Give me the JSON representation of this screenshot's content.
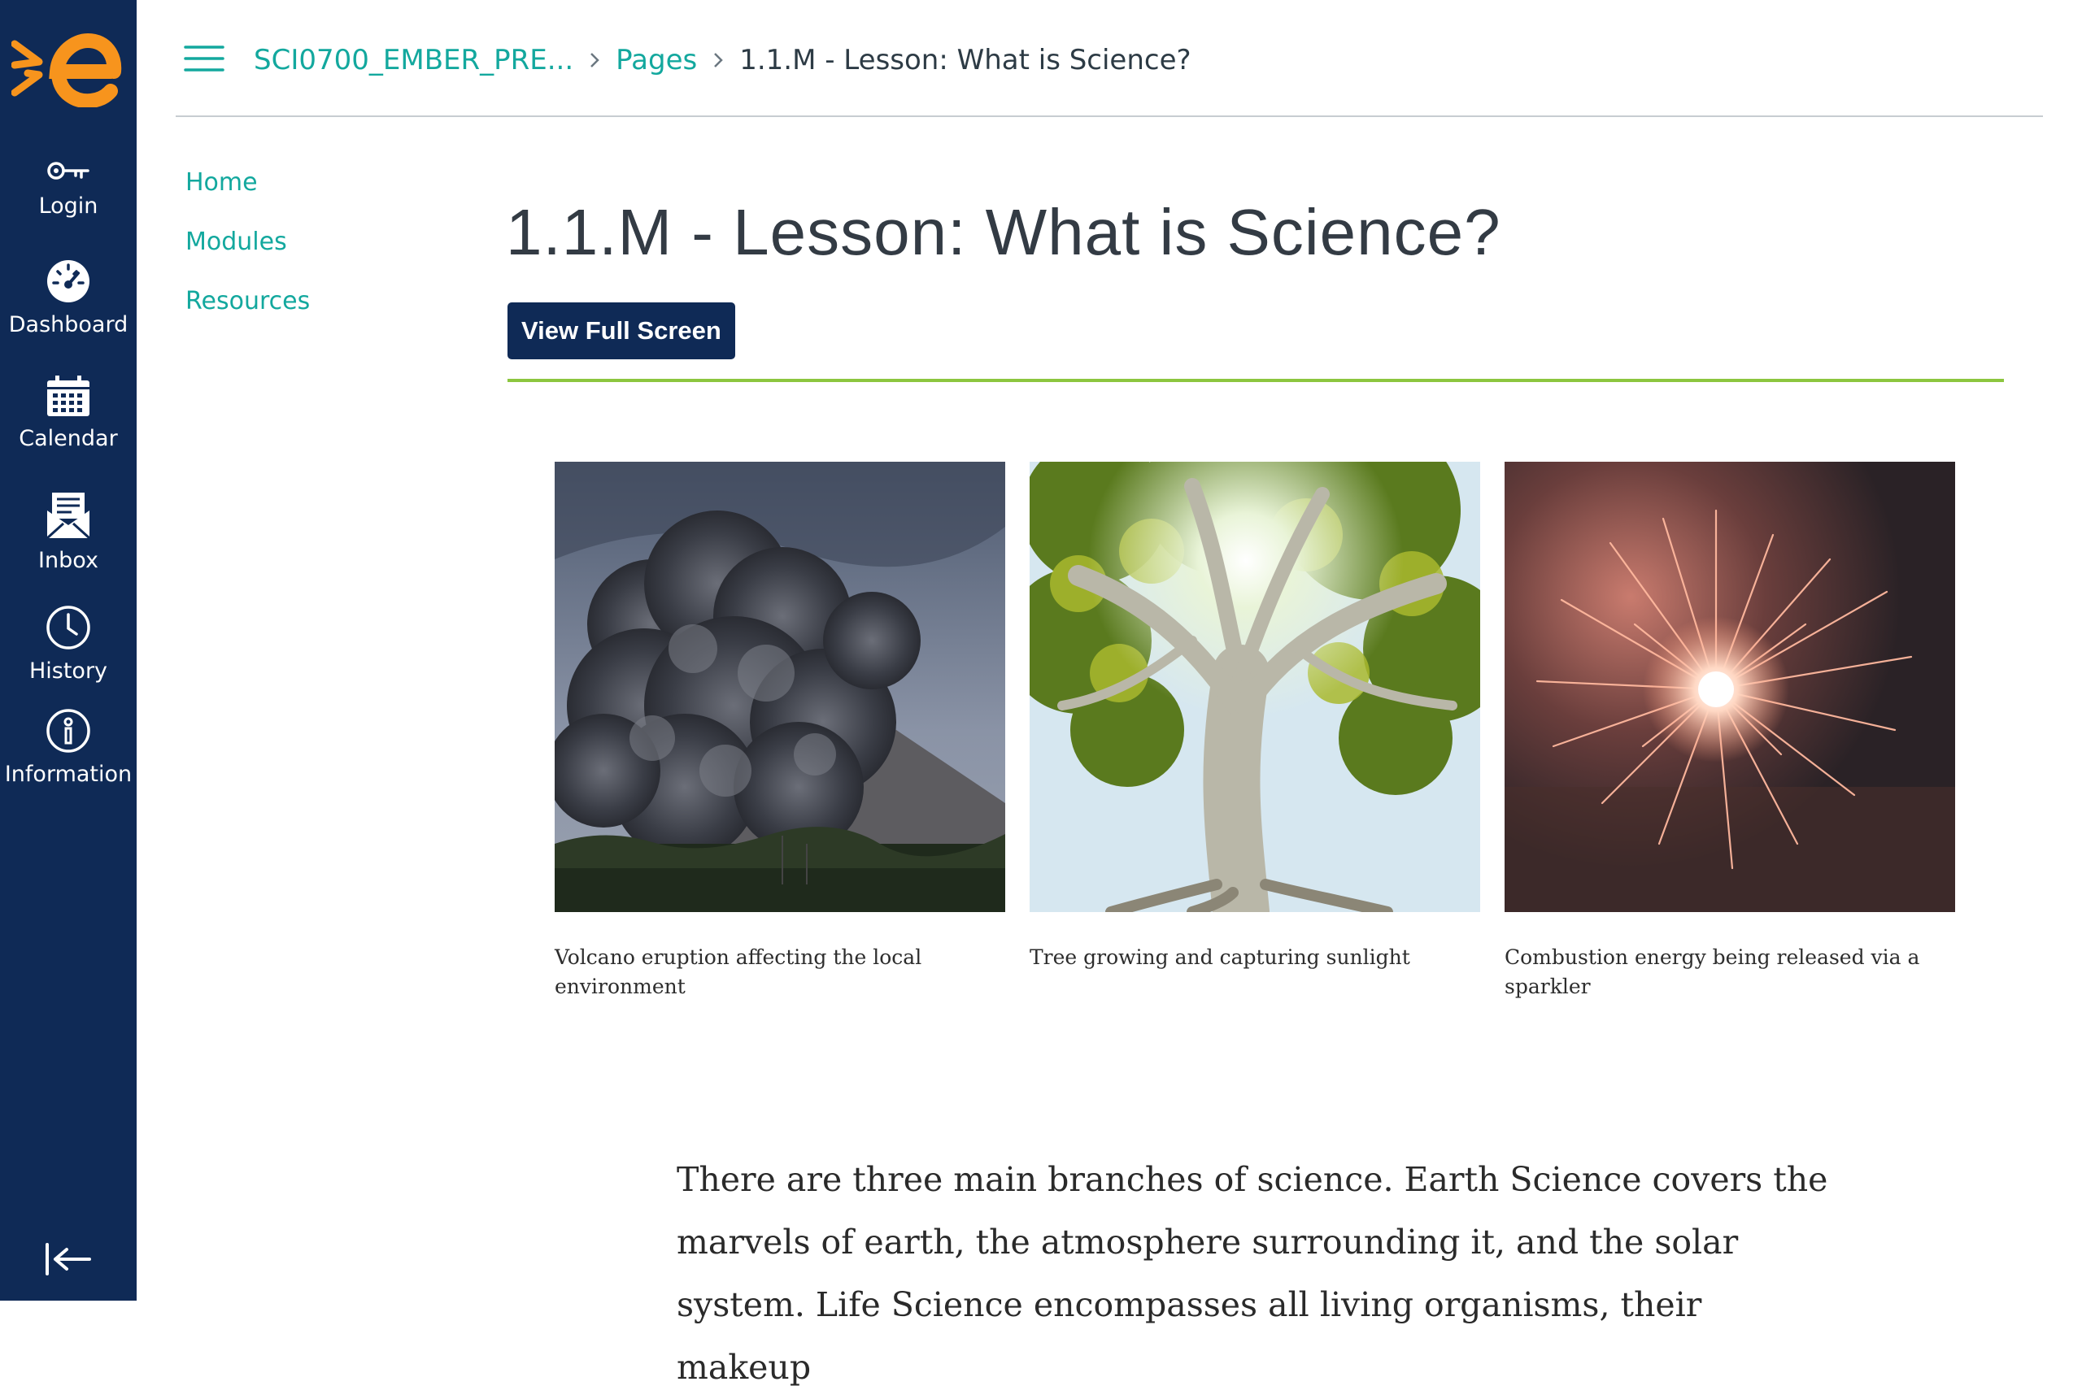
{
  "global_nav": {
    "logo_alt": "e",
    "items": [
      {
        "label": "Login",
        "icon": "key-icon"
      },
      {
        "label": "Dashboard",
        "icon": "dashboard-icon"
      },
      {
        "label": "Calendar",
        "icon": "calendar-icon"
      },
      {
        "label": "Inbox",
        "icon": "inbox-icon"
      },
      {
        "label": "History",
        "icon": "clock-icon"
      },
      {
        "label": "Information",
        "icon": "info-icon"
      }
    ],
    "collapse_icon": "collapse-nav-icon",
    "colors": {
      "background": "#0f2a56",
      "logo": "#f7941d"
    }
  },
  "breadcrumb": {
    "course": "SCI0700_EMBER_PRE...",
    "section": "Pages",
    "current": "1.1.M - Lesson: What is Science?"
  },
  "course_nav": {
    "items": [
      "Home",
      "Modules",
      "Resources"
    ]
  },
  "page": {
    "title": "1.1.M - Lesson: What is Science?",
    "fullscreen_button": "View Full Screen",
    "figures": [
      {
        "caption": "Volcano eruption affecting the local environment",
        "subject": "volcano-photo"
      },
      {
        "caption": "Tree growing and capturing sunlight",
        "subject": "tree-photo"
      },
      {
        "caption": "Combustion energy being released via a sparkler",
        "subject": "sparkler-photo"
      }
    ],
    "body_text": "There are three main branches of science. Earth Science covers the marvels of earth, the atmosphere surrounding it, and the solar system. Life Science encompasses all living organisms, their makeup"
  },
  "colors": {
    "link": "#13a89e",
    "accent_rule": "#8cc63f",
    "button": "#0f2a56"
  }
}
